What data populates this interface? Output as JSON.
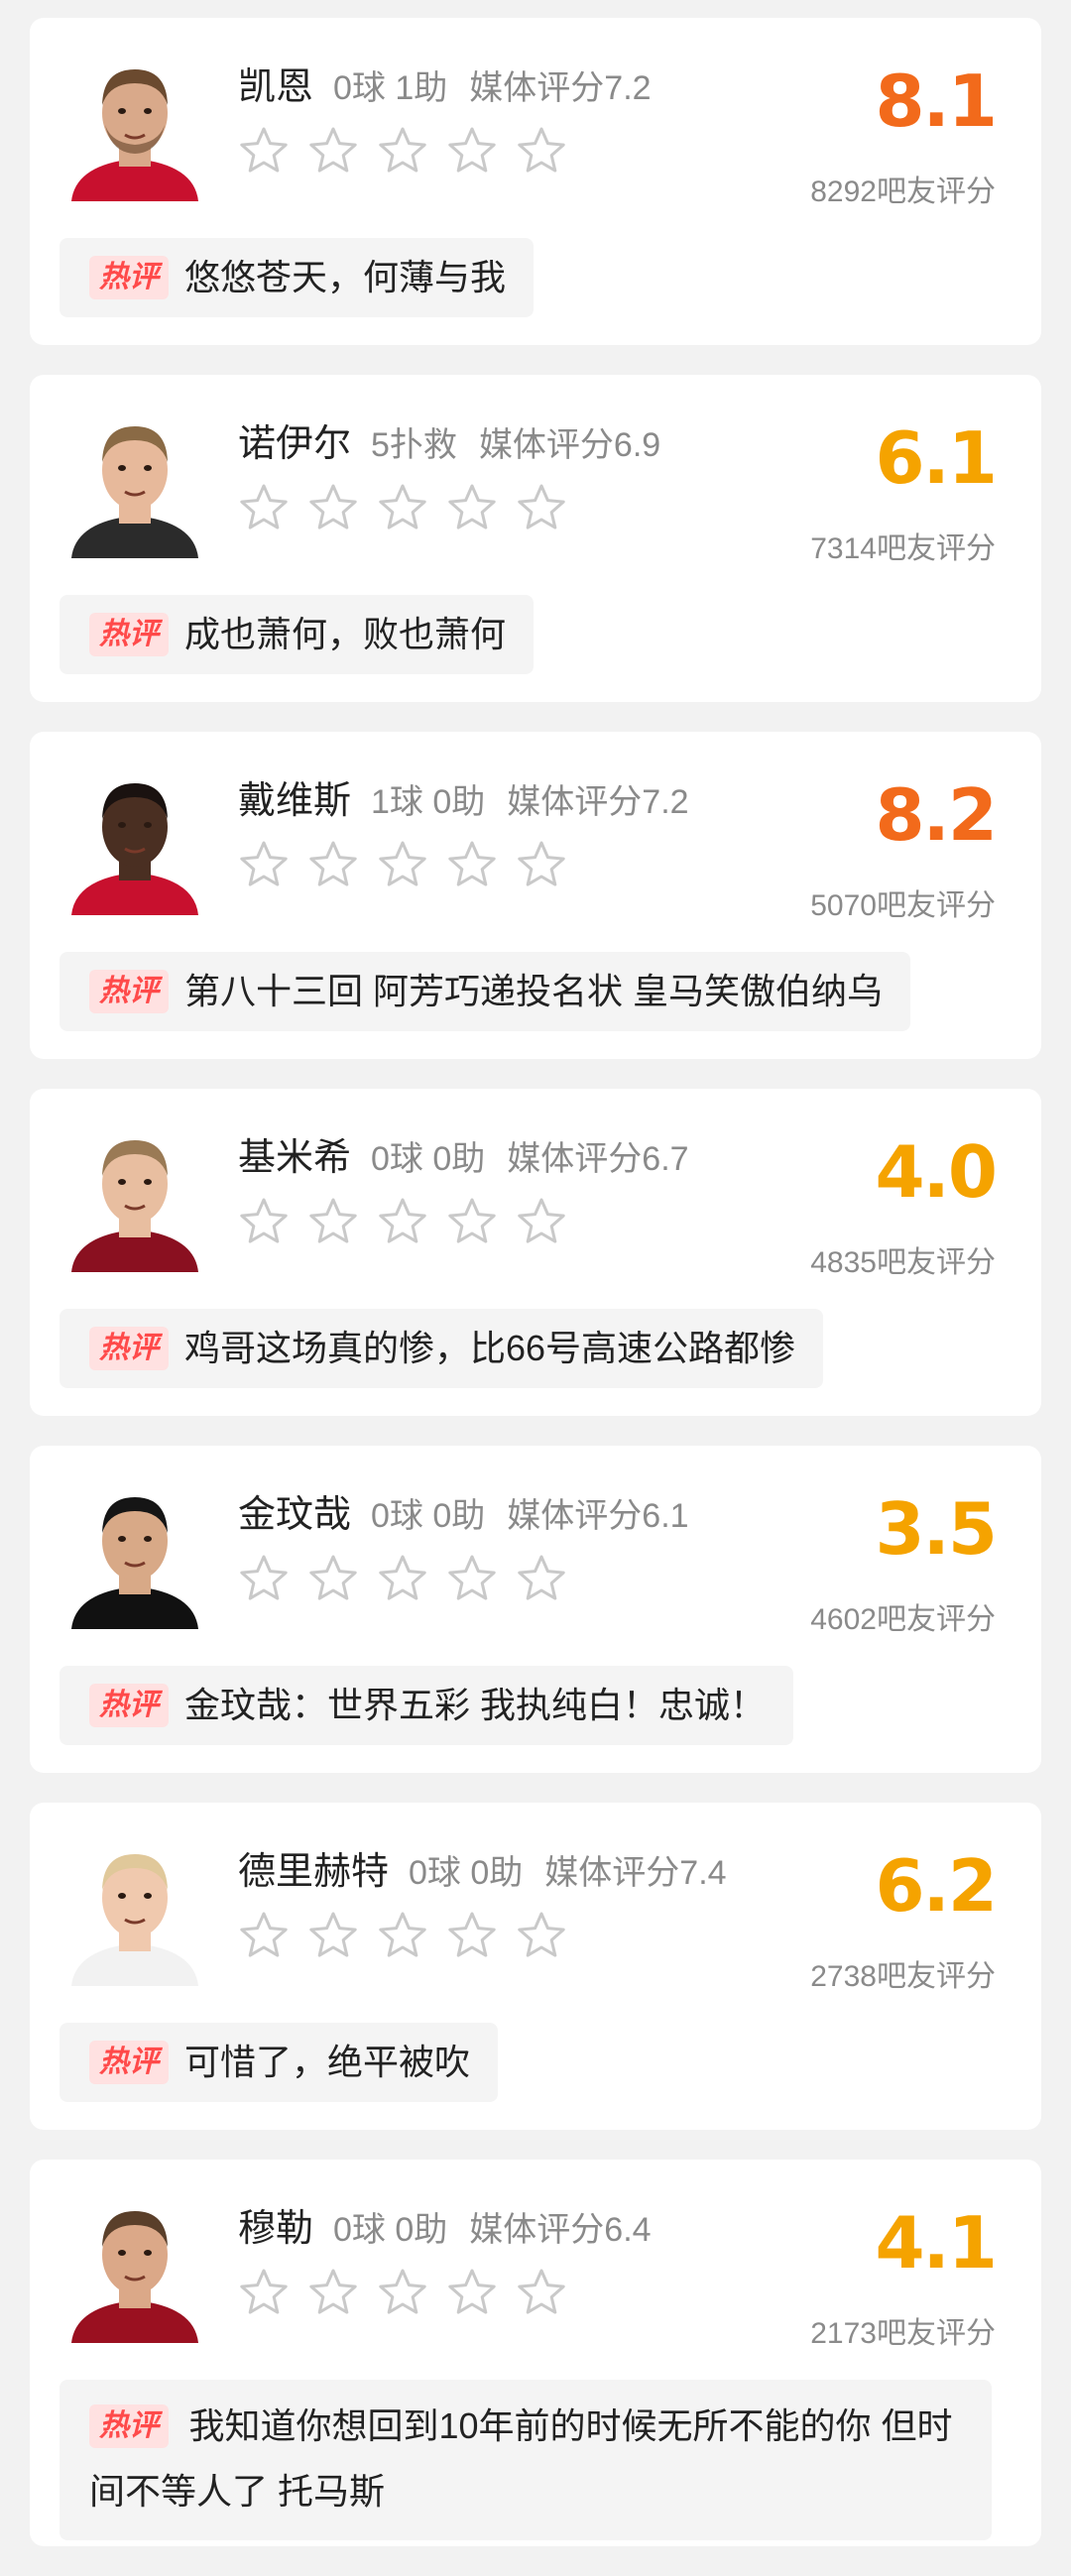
{
  "badge_label": "热评",
  "rating_suffix": "吧友评分",
  "colors": {
    "score_red": "#f26a1b",
    "score_orange": "#f5a300",
    "badge_bg": "#ffe1e1",
    "badge_text": "#ff4a4a"
  },
  "players": [
    {
      "name": "凯恩",
      "stat": "0球 1助",
      "media": "媒体评分7.2",
      "score": "8.1",
      "score_color": "#f26a1b",
      "count": "8292吧友评分",
      "comment": "悠悠苍天，何薄与我"
    },
    {
      "name": "诺伊尔",
      "stat": "5扑救",
      "media": "媒体评分6.9",
      "score": "6.1",
      "score_color": "#f5a300",
      "count": "7314吧友评分",
      "comment": "成也萧何，败也萧何"
    },
    {
      "name": "戴维斯",
      "stat": "1球 0助",
      "media": "媒体评分7.2",
      "score": "8.2",
      "score_color": "#f26a1b",
      "count": "5070吧友评分",
      "comment": "第八十三回 阿芳巧递投名状 皇马笑傲伯纳乌"
    },
    {
      "name": "基米希",
      "stat": "0球 0助",
      "media": "媒体评分6.7",
      "score": "4.0",
      "score_color": "#f5a300",
      "count": "4835吧友评分",
      "comment": "鸡哥这场真的惨，比66号高速公路都惨"
    },
    {
      "name": "金玟哉",
      "stat": "0球 0助",
      "media": "媒体评分6.1",
      "score": "3.5",
      "score_color": "#f5a300",
      "count": "4602吧友评分",
      "comment": "金玟哉：世界五彩 我执纯白！忠诚！"
    },
    {
      "name": "德里赫特",
      "stat": "0球 0助",
      "media": "媒体评分7.4",
      "score": "6.2",
      "score_color": "#f5a300",
      "count": "2738吧友评分",
      "comment": "可惜了，绝平被吹"
    },
    {
      "name": "穆勒",
      "stat": "0球 0助",
      "media": "媒体评分6.4",
      "score": "4.1",
      "score_color": "#f5a300",
      "count": "2173吧友评分",
      "comment": "我知道你想回到10年前的时候无所不能的你 但时间不等人了 托马斯"
    }
  ]
}
